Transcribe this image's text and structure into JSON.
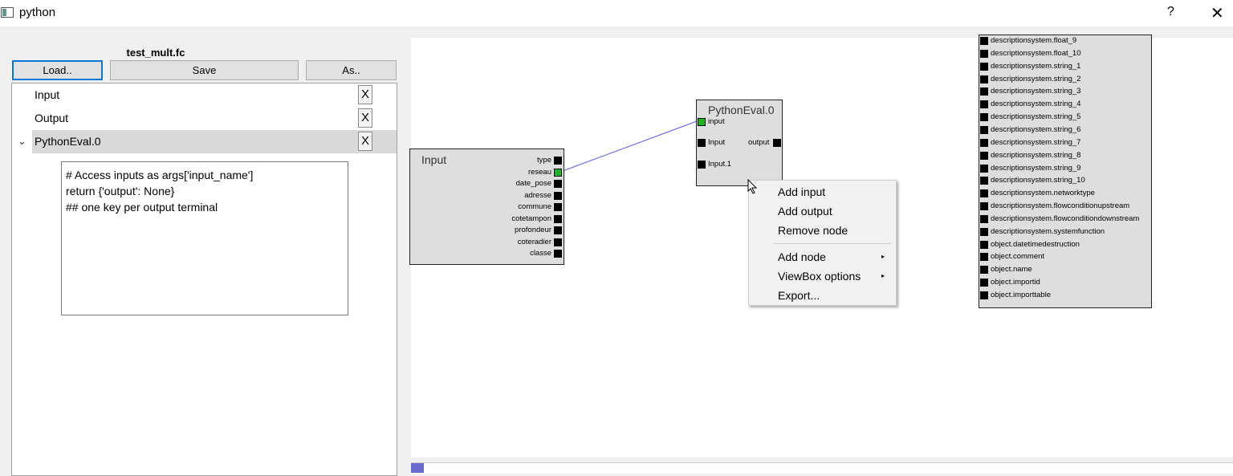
{
  "window": {
    "title": "python",
    "help": "?",
    "close": "✕"
  },
  "left_panel": {
    "filename": "test_mult.fc",
    "buttons": {
      "load": "Load..",
      "save": "Save",
      "as": "As.."
    },
    "tree": [
      {
        "label": "Input",
        "remove": "X"
      },
      {
        "label": "Output",
        "remove": "X"
      },
      {
        "label": "PythonEval.0",
        "remove": "X",
        "expanded": true
      }
    ],
    "code_lines": [
      "# Access inputs as args['input_name']",
      "return {'output': None}",
      "## one key per output terminal"
    ]
  },
  "canvas": {
    "input_node": {
      "title": "Input",
      "ports": [
        "type",
        "reseau",
        "date_pose",
        "adresse",
        "commune",
        "cotetampon",
        "profondeur",
        "coteradier",
        "classe"
      ],
      "active_port": "reseau"
    },
    "python_node": {
      "title": "PythonEval.0",
      "inputs": [
        "input",
        "Input",
        "Input.1"
      ],
      "outputs": [
        "output"
      ],
      "active_port": "input"
    },
    "output_node": {
      "ports": [
        "descriptionsystem.float_9",
        "descriptionsystem.float_10",
        "descriptionsystem.string_1",
        "descriptionsystem.string_2",
        "descriptionsystem.string_3",
        "descriptionsystem.string_4",
        "descriptionsystem.string_5",
        "descriptionsystem.string_6",
        "descriptionsystem.string_7",
        "descriptionsystem.string_8",
        "descriptionsystem.string_9",
        "descriptionsystem.string_10",
        "descriptionsystem.networktype",
        "descriptionsystem.flowconditionupstream",
        "descriptionsystem.flowconditiondownstream",
        "descriptionsystem.systemfunction",
        "object.datetimedestruction",
        "object.comment",
        "object.name",
        "object.importid",
        "object.importtable"
      ]
    }
  },
  "context_menu": {
    "items": [
      "Add input",
      "Add output",
      "Remove node",
      "Add node",
      "ViewBox options",
      "Export..."
    ],
    "submenu_arrow": "▸"
  },
  "colors": {
    "active_port": "#1fb51f",
    "edge": "#5555dd",
    "focus": "#0078d7"
  }
}
